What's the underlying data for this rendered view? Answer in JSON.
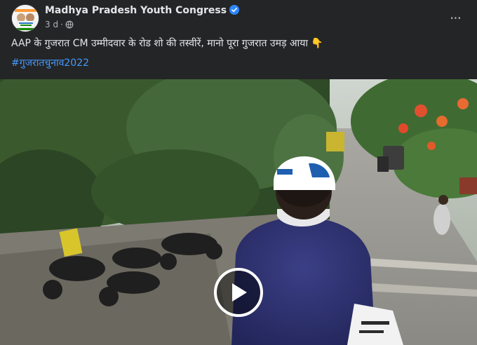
{
  "post": {
    "author": "Madhya Pradesh Youth Congress",
    "time": "3 d",
    "dot": "·",
    "caption": "AAP के गुजरात CM उम्मीदवार के रोड शो की तस्वीरें, मानो पूरा गुजरात उमड़ आया",
    "caption_emoji": "👇",
    "hashtag": "#गुजरातचुनाव2022",
    "more_label": "···"
  },
  "icons": {
    "avatar": "congress-logo-avatar",
    "verified": "verified-badge-icon",
    "audience": "globe-icon",
    "more": "more-options-icon",
    "play": "play-icon"
  },
  "colors": {
    "background": "#242526",
    "text": "#e4e6eb",
    "secondary_text": "#b0b3b8",
    "link": "#4599ff",
    "verified": "#2d88ff"
  }
}
